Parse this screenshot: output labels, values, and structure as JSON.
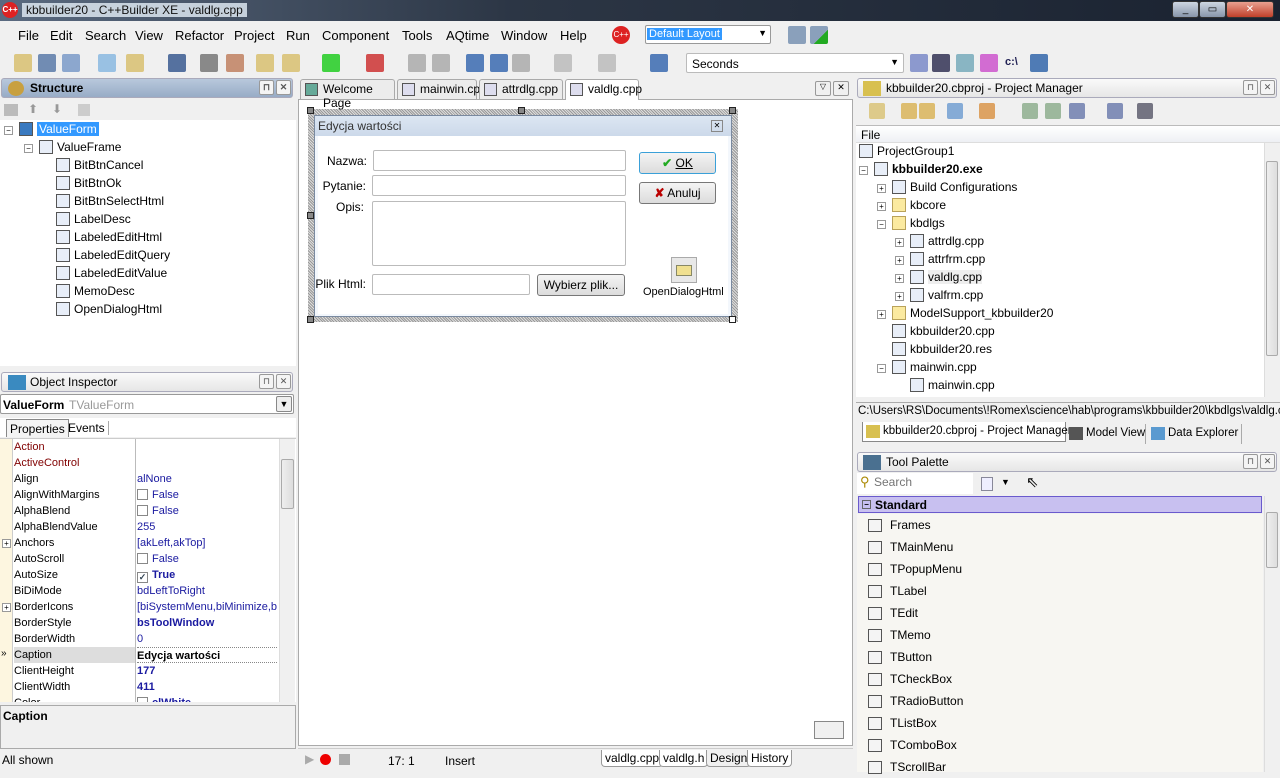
{
  "window": {
    "title": "kbbuilder20 - C++Builder XE - valdlg.cpp",
    "controls": [
      "_",
      "▭",
      "✕"
    ]
  },
  "menu": [
    "File",
    "Edit",
    "Search",
    "View",
    "Refactor",
    "Project",
    "Run",
    "Component",
    "Tools",
    "AQtime",
    "Window",
    "Help"
  ],
  "toolbar": {
    "layout_value": "Default Layout",
    "profiler_unit": "Seconds",
    "cmd_label": "c:\\"
  },
  "structure": {
    "title": "Structure",
    "root": "ValueForm",
    "frame": "ValueFrame",
    "children": [
      "BitBtnCancel",
      "BitBtnOk",
      "BitBtnSelectHtml",
      "LabelDesc",
      "LabeledEditHtml",
      "LabeledEditQuery",
      "LabeledEditValue",
      "MemoDesc",
      "OpenDialogHtml"
    ]
  },
  "inspector": {
    "title": "Object Inspector",
    "object_name": "ValueForm",
    "object_type": "TValueForm",
    "tabs": [
      "Properties",
      "Events"
    ],
    "properties": [
      {
        "name": "Action",
        "value": "",
        "kind": "ref"
      },
      {
        "name": "ActiveControl",
        "value": "",
        "kind": "ref"
      },
      {
        "name": "Align",
        "value": "alNone"
      },
      {
        "name": "AlignWithMargins",
        "value": "False",
        "check": false
      },
      {
        "name": "AlphaBlend",
        "value": "False",
        "check": false
      },
      {
        "name": "AlphaBlendValue",
        "value": "255"
      },
      {
        "name": "Anchors",
        "value": "[akLeft,akTop]",
        "expand": true
      },
      {
        "name": "AutoScroll",
        "value": "False",
        "check": false
      },
      {
        "name": "AutoSize",
        "value": "True",
        "check": true,
        "bold": true
      },
      {
        "name": "BiDiMode",
        "value": "bdLeftToRight"
      },
      {
        "name": "BorderIcons",
        "value": "[biSystemMenu,biMinimize,biMaximize]",
        "expand": true
      },
      {
        "name": "BorderStyle",
        "value": "bsToolWindow",
        "bold": true
      },
      {
        "name": "BorderWidth",
        "value": "0"
      },
      {
        "name": "Caption",
        "value": "Edycja wartości",
        "bold": true,
        "selected": true
      },
      {
        "name": "ClientHeight",
        "value": "177",
        "bold": true
      },
      {
        "name": "ClientWidth",
        "value": "411",
        "bold": true
      },
      {
        "name": "Color",
        "value": "clWhite",
        "check": false,
        "bold": true
      }
    ],
    "description_title": "Caption",
    "status": "All shown"
  },
  "editor": {
    "tabs": [
      "Welcome Page",
      "mainwin.cpp",
      "attrdlg.cpp",
      "valdlg.cpp"
    ],
    "active_tab": 3,
    "form": {
      "caption": "Edycja wartości",
      "labels": {
        "name": "Nazwa:",
        "question": "Pytanie:",
        "desc": "Opis:",
        "html": "Plik Html:"
      },
      "ok": "OK",
      "cancel": "Anuluj",
      "select_file": "Wybierz plik...",
      "dialog_component": "OpenDialogHtml"
    },
    "status": {
      "position": "17:  1",
      "mode": "Insert"
    },
    "bottom_tabs": [
      "valdlg.cpp",
      "valdlg.h",
      "Design",
      "History"
    ],
    "active_bottom_tab": 2
  },
  "project_manager": {
    "title": "kbbuilder20.cbproj - Project Manager",
    "column": "File",
    "tree": [
      {
        "label": "ProjectGroup1",
        "level": 0
      },
      {
        "label": "kbbuilder20.exe",
        "level": 0,
        "bold": true,
        "toggle": "-"
      },
      {
        "label": "Build Configurations",
        "level": 1,
        "toggle": "+"
      },
      {
        "label": "kbcore",
        "level": 1,
        "toggle": "+",
        "folder": true
      },
      {
        "label": "kbdlgs",
        "level": 1,
        "toggle": "-",
        "folder": true
      },
      {
        "label": "attrdlg.cpp",
        "level": 2,
        "toggle": "+"
      },
      {
        "label": "attrfrm.cpp",
        "level": 2,
        "toggle": "+"
      },
      {
        "label": "valdlg.cpp",
        "level": 2,
        "toggle": "+",
        "selected": true
      },
      {
        "label": "valfrm.cpp",
        "level": 2,
        "toggle": "+"
      },
      {
        "label": "ModelSupport_kbbuilder20",
        "level": 1,
        "toggle": "+",
        "folder": true
      },
      {
        "label": "kbbuilder20.cpp",
        "level": 1
      },
      {
        "label": "kbbuilder20.res",
        "level": 1
      },
      {
        "label": "mainwin.cpp",
        "level": 1,
        "toggle": "-"
      },
      {
        "label": "mainwin.cpp",
        "level": 2
      }
    ],
    "path": "C:\\Users\\RS\\Documents\\!Romex\\science\\hab\\programs\\kbbuilder20\\kbdlgs\\valdlg.cpp",
    "tabs": [
      "kbbuilder20.cbproj - Project Manager",
      "Model View",
      "Data Explorer"
    ]
  },
  "tool_palette": {
    "title": "Tool Palette",
    "search_placeholder": "Search",
    "category": "Standard",
    "items": [
      "Frames",
      "TMainMenu",
      "TPopupMenu",
      "TLabel",
      "TEdit",
      "TMemo",
      "TButton",
      "TCheckBox",
      "TRadioButton",
      "TListBox",
      "TComboBox",
      "TScrollBar"
    ]
  },
  "colors": {
    "accent_selection": "#3399ff",
    "category_bg": "#c8c0f0",
    "ref_prop": "#800000",
    "value_text": "#1a1aa0"
  }
}
